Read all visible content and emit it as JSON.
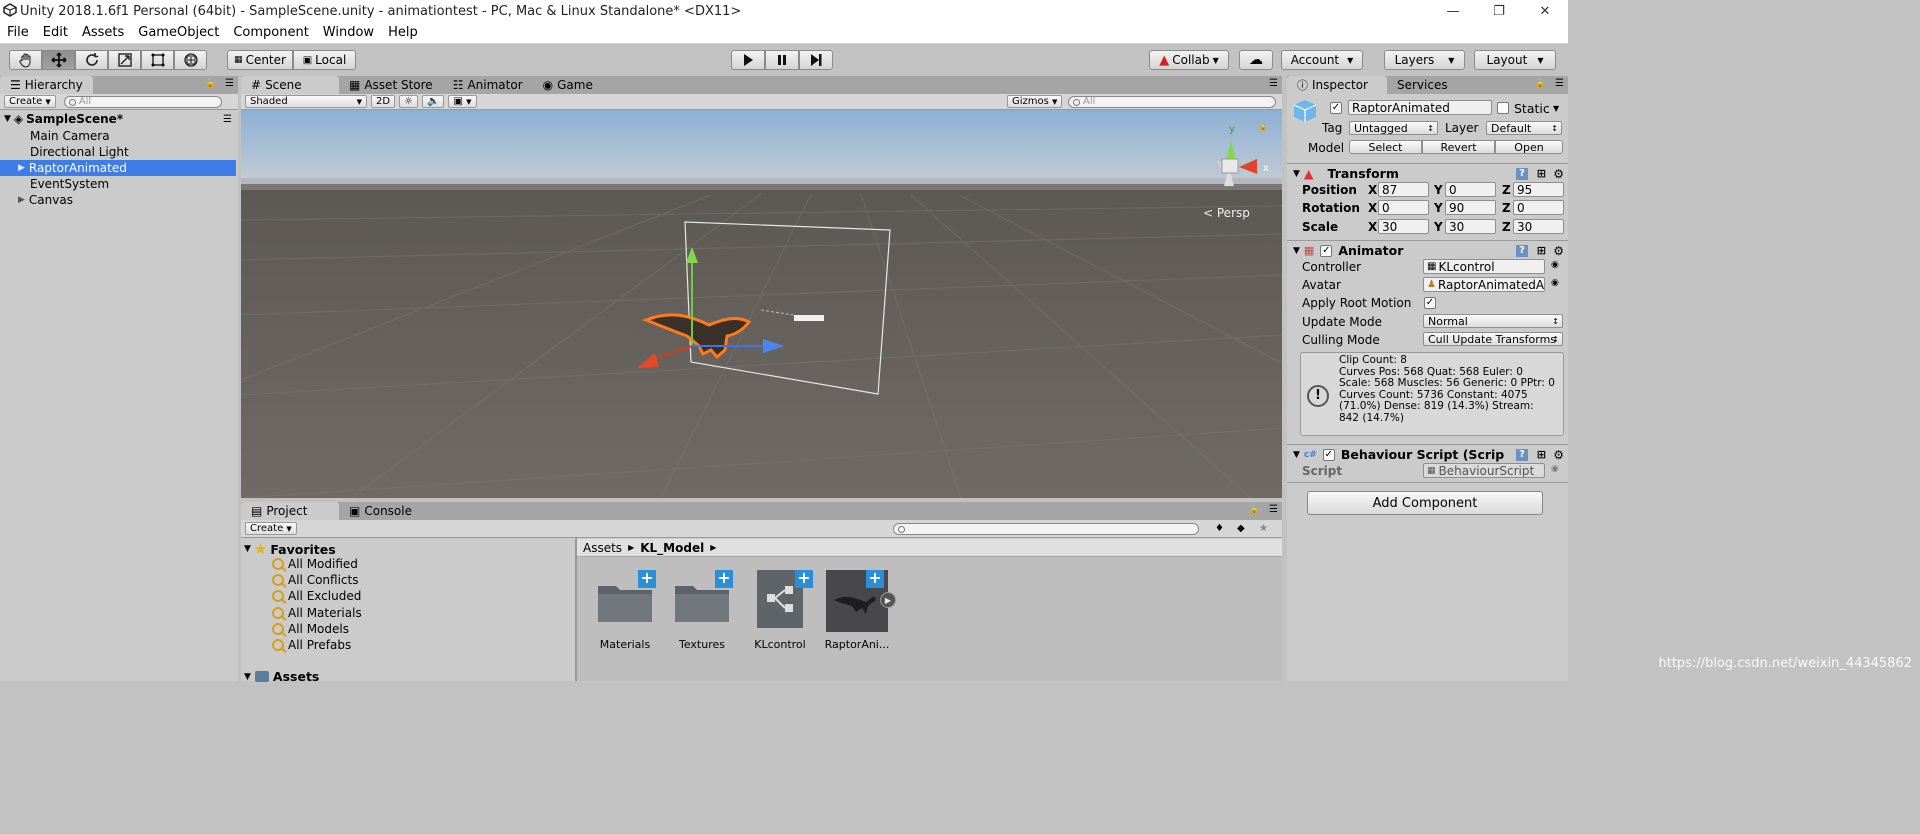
{
  "window": {
    "title": "Unity 2018.1.6f1 Personal (64bit) - SampleScene.unity - animationtest - PC, Mac & Linux Standalone* <DX11>"
  },
  "menu": [
    "File",
    "Edit",
    "Assets",
    "GameObject",
    "Component",
    "Window",
    "Help"
  ],
  "toolbar": {
    "center": "Center",
    "local": "Local",
    "collab": "Collab",
    "account": "Account",
    "layers": "Layers",
    "layout": "Layout"
  },
  "hierarchy": {
    "tab": "Hierarchy",
    "create": "Create",
    "search": "All",
    "scene": "SampleScene*",
    "items": [
      "Main Camera",
      "Directional Light",
      "RaptorAnimated",
      "EventSystem",
      "Canvas"
    ]
  },
  "scene": {
    "tabs": [
      "Scene",
      "Asset Store",
      "Animator",
      "Game"
    ],
    "shading": "Shaded",
    "mode2d": "2D",
    "gizmos": "Gizmos",
    "search": "All",
    "persp": "Persp"
  },
  "inspector": {
    "tabs": [
      "Inspector",
      "Services"
    ],
    "object_name": "RaptorAnimated",
    "static": "Static",
    "tag_label": "Tag",
    "tag": "Untagged",
    "layer_label": "Layer",
    "layer": "Default",
    "model_label": "Model",
    "select": "Select",
    "revert": "Revert",
    "open": "Open",
    "transform": {
      "title": "Transform",
      "position": "Position",
      "rotation": "Rotation",
      "scale": "Scale",
      "pos": [
        "87",
        "0",
        "95"
      ],
      "rot": [
        "0",
        "90",
        "0"
      ],
      "scl": [
        "30",
        "30",
        "30"
      ]
    },
    "animator": {
      "title": "Animator",
      "controller_label": "Controller",
      "controller": "KLcontrol",
      "avatar_label": "Avatar",
      "avatar": "RaptorAnimatedA",
      "root_motion": "Apply Root Motion",
      "update_label": "Update Mode",
      "update": "Normal",
      "culling_label": "Culling Mode",
      "culling": "Cull Update Transforms",
      "info": [
        "Clip Count: 8",
        "Curves Pos: 568 Quat: 568 Euler: 0",
        "Scale: 568 Muscles: 56 Generic: 0 PPtr: 0",
        "Curves Count: 5736 Constant: 4075",
        "(71.0%) Dense: 819 (14.3%) Stream:",
        "842 (14.7%)"
      ]
    },
    "script": {
      "title": "Behaviour Script (Scrip",
      "label": "Script",
      "value": "BehaviourScript"
    },
    "add_component": "Add Component"
  },
  "project": {
    "tabs": [
      "Project",
      "Console"
    ],
    "create": "Create",
    "favorites": "Favorites",
    "fav_items": [
      "All Modified",
      "All Conflicts",
      "All Excluded",
      "All Materials",
      "All Models",
      "All Prefabs"
    ],
    "assets_root": "Assets",
    "breadcrumb": [
      "Assets",
      "KL_Model"
    ],
    "assets": [
      "Materials",
      "Textures",
      "KLcontrol",
      "RaptorAni..."
    ]
  },
  "watermark": "https://blog.csdn.net/weixin_44345862"
}
